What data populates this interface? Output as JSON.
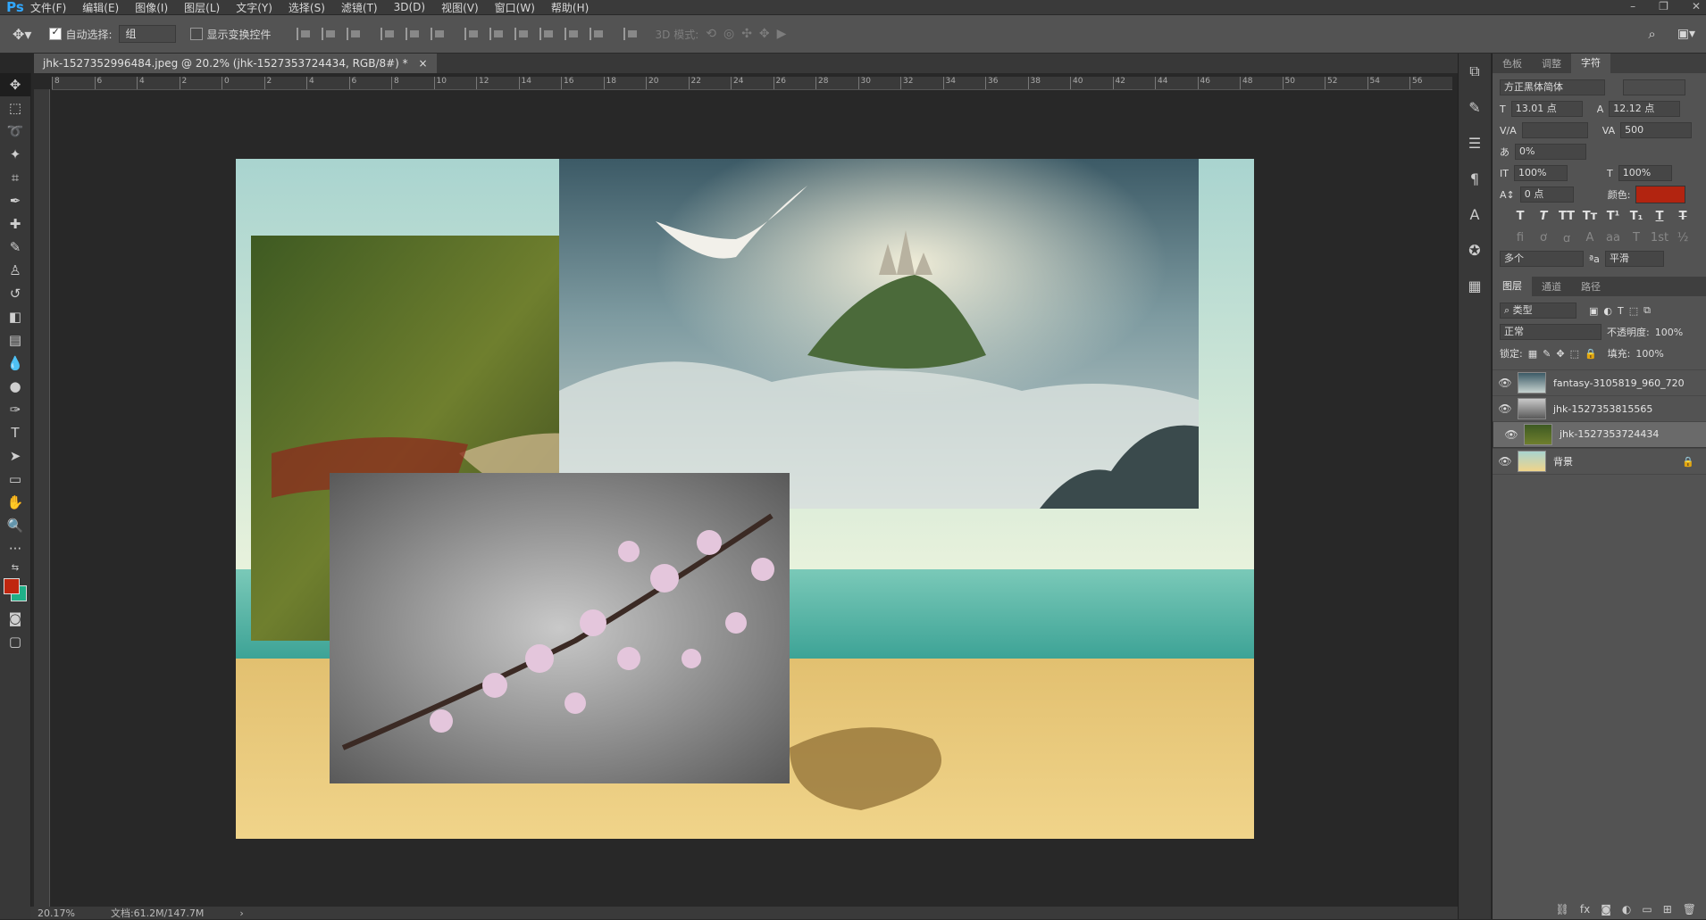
{
  "app": {
    "logo": "Ps"
  },
  "menu": [
    "文件(F)",
    "编辑(E)",
    "图像(I)",
    "图层(L)",
    "文字(Y)",
    "选择(S)",
    "滤镜(T)",
    "3D(D)",
    "视图(V)",
    "窗口(W)",
    "帮助(H)"
  ],
  "options": {
    "auto_select_label": "自动选择:",
    "auto_select_value": "组",
    "show_transform_label": "显示变换控件",
    "mode_3d_label": "3D 模式:"
  },
  "document": {
    "tab_title": "jhk-1527352996484.jpeg @ 20.2% (jhk-1527353724434, RGB/8#) *",
    "close": "×"
  },
  "ruler_top_labels": [
    "8",
    "6",
    "4",
    "2",
    "0",
    "2",
    "4",
    "6",
    "8",
    "10",
    "12",
    "14",
    "16",
    "18",
    "20",
    "22",
    "24",
    "26",
    "28",
    "30",
    "32",
    "34",
    "36",
    "38",
    "40",
    "42",
    "44",
    "46",
    "48",
    "50",
    "52",
    "54",
    "56"
  ],
  "status": {
    "zoom": "20.17%",
    "doc": "文档:61.2M/147.7M"
  },
  "character_panel": {
    "tabs": [
      "色板",
      "调整",
      "字符"
    ],
    "active_tab": "字符",
    "font_family": "方正黑体简体",
    "font_size": "13.01 点",
    "leading": "12.12 点",
    "kerning": "",
    "tracking": "500",
    "scale_percent": "0%",
    "vertical_scale": "100%",
    "horizontal_scale": "100%",
    "baseline_shift": "0 点",
    "color_label": "颜色:",
    "color": "#b22410",
    "language": "多个",
    "antialias": "平滑"
  },
  "layers_panel": {
    "tabs": [
      "图层",
      "通道",
      "路径"
    ],
    "active_tab": "图层",
    "filter": "类型",
    "blend_mode": "正常",
    "opacity_label": "不透明度:",
    "opacity": "100%",
    "lock_label": "锁定:",
    "fill_label": "填充:",
    "fill": "100%",
    "layers": [
      {
        "name": "fantasy-3105819_960_720",
        "selected": false
      },
      {
        "name": "jhk-1527353815565",
        "selected": false
      },
      {
        "name": "jhk-1527353724434",
        "selected": true
      },
      {
        "name": "背景",
        "selected": false
      }
    ]
  },
  "colors": {
    "foreground": "#c0260f",
    "background": "#1fb088"
  }
}
